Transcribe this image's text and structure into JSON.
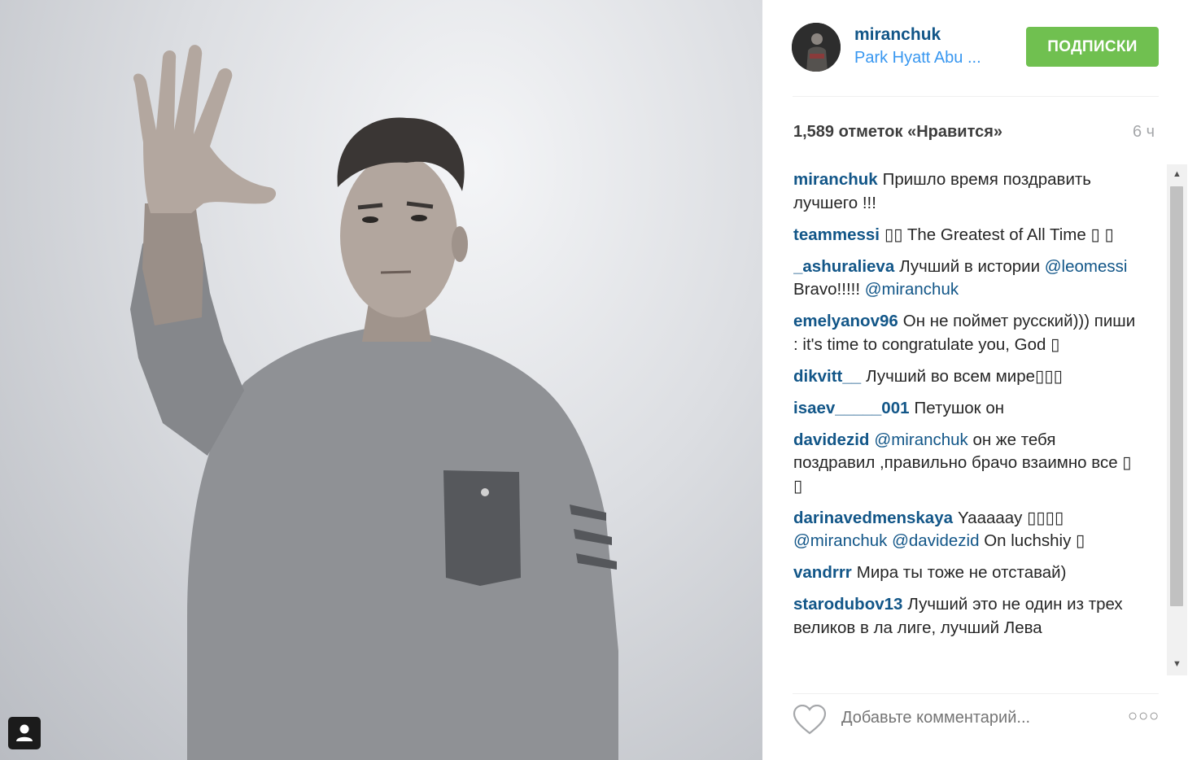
{
  "post": {
    "image_alt": "Photo: man in grey sweatshirt raising an open hand"
  },
  "header": {
    "username": "miranchuk",
    "location": "Park Hyatt Abu ...",
    "follow_label": "ПОДПИСКИ"
  },
  "stats": {
    "likes": "1,589 отметок «Нравится»",
    "time": "6 ч"
  },
  "comments": [
    {
      "author": "miranchuk",
      "parts": [
        {
          "t": "Пришло время поздравить лучшего !!!"
        }
      ]
    },
    {
      "author": "teammessi",
      "parts": [
        {
          "t": "▯▯ The Greatest of All Time ▯ ▯"
        }
      ]
    },
    {
      "author": "_ashuralieva",
      "parts": [
        {
          "t": "Лучший в истории "
        },
        {
          "m": "@leomessi"
        },
        {
          "t": " Bravo!!!!! "
        },
        {
          "m": "@miranchuk"
        }
      ]
    },
    {
      "author": "emelyanov96",
      "parts": [
        {
          "t": "Он не поймет русский))) пиши : it's time to congratulate you, God ▯"
        }
      ]
    },
    {
      "author": "dikvitt__",
      "parts": [
        {
          "t": "Лучший во всем мире▯▯▯"
        }
      ]
    },
    {
      "author": "isaev_____001",
      "parts": [
        {
          "t": "Петушок он"
        }
      ]
    },
    {
      "author": "davidezid",
      "parts": [
        {
          "m": "@miranchuk"
        },
        {
          "t": " он же тебя поздравил ,правильно брачо взаимно все ▯ ▯"
        }
      ]
    },
    {
      "author": "darinavedmenskaya",
      "parts": [
        {
          "t": "Yaaaaay ▯▯▯▯ "
        },
        {
          "m": "@miranchuk"
        },
        {
          "t": " "
        },
        {
          "m": "@davidezid"
        },
        {
          "t": " On luchshiy ▯"
        }
      ]
    },
    {
      "author": "vandrrr",
      "parts": [
        {
          "t": "Мира ты тоже не отставай)"
        }
      ]
    },
    {
      "author": "starodubov13",
      "parts": [
        {
          "t": "Лучший это не один из трех великов в ла лиге, лучший Лева"
        }
      ]
    }
  ],
  "footer": {
    "comment_placeholder": "Добавьте комментарий...",
    "more_label": "○○○"
  },
  "icons": {
    "heart": "heart-icon",
    "user_tag": "user-tag-icon",
    "scroll_up": "▲",
    "scroll_down": "▼"
  },
  "colors": {
    "follow_button": "#70c050",
    "username": "#125688",
    "location": "#3897f0",
    "muted": "#a5a7aa"
  }
}
